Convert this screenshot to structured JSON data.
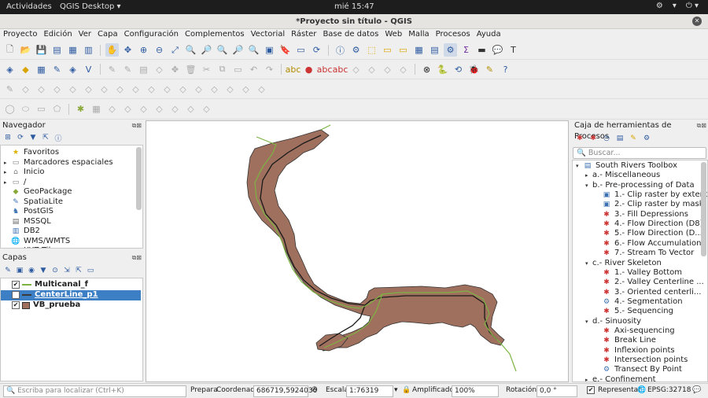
{
  "topbar": {
    "activities": "Actividades",
    "app": "QGIS Desktop ▾",
    "clock": "mié 15:47",
    "sys": [
      "⚙",
      "▾",
      "⏻ ▾"
    ]
  },
  "window": {
    "title": "*Proyecto sin título - QGIS"
  },
  "menu": [
    "Proyecto",
    "Edición",
    "Ver",
    "Capa",
    "Configuración",
    "Complementos",
    "Vectorial",
    "Ráster",
    "Base de datos",
    "Web",
    "Malla",
    "Procesos",
    "Ayuda"
  ],
  "browser": {
    "title": "Navegador",
    "items": [
      {
        "label": "Favoritos",
        "icon": "★",
        "color": "#e0b000",
        "expand": ""
      },
      {
        "label": "Marcadores espaciales",
        "icon": "▭",
        "color": "#777",
        "expand": "▸"
      },
      {
        "label": "Inicio",
        "icon": "⌂",
        "color": "#777",
        "expand": "▸"
      },
      {
        "label": "/",
        "icon": "▭",
        "color": "#777",
        "expand": "▸"
      },
      {
        "label": "GeoPackage",
        "icon": "◆",
        "color": "#8aa83a",
        "expand": ""
      },
      {
        "label": "SpatiaLite",
        "icon": "✎",
        "color": "#3a6fb0",
        "expand": ""
      },
      {
        "label": "PostGIS",
        "icon": "♞",
        "color": "#3a6fb0",
        "expand": ""
      },
      {
        "label": "MSSQL",
        "icon": "▤",
        "color": "#666",
        "expand": ""
      },
      {
        "label": "DB2",
        "icon": "▥",
        "color": "#3a6fb0",
        "expand": ""
      },
      {
        "label": "WMS/WMTS",
        "icon": "🌐",
        "color": "#3a6fb0",
        "expand": ""
      },
      {
        "label": "XYZ Tiles",
        "icon": "▦",
        "color": "#666",
        "expand": ""
      }
    ]
  },
  "layers": {
    "title": "Capas",
    "items": [
      {
        "label": "Multicanal_f",
        "kind": "line",
        "color": "#7cb342",
        "selected": false
      },
      {
        "label": "CenterLine_p1",
        "kind": "line",
        "color": "#3a3a3a",
        "selected": true
      },
      {
        "label": "VB_prueba",
        "kind": "poly",
        "color": "#a0705e",
        "selected": false
      }
    ]
  },
  "toolbox": {
    "title": "Caja de herramientas de Procesos",
    "search_placeholder": "Buscar...",
    "items": [
      {
        "label": "South Rivers Toolbox",
        "level": 0,
        "expand": "▾",
        "icon": "▤"
      },
      {
        "label": "a.- Miscellaneous",
        "level": 1,
        "expand": "▸",
        "icon": ""
      },
      {
        "label": "b.- Pre-processing of Data",
        "level": 1,
        "expand": "▾",
        "icon": ""
      },
      {
        "label": "1.- Clip raster by extent",
        "level": 2,
        "expand": "",
        "icon": "▣"
      },
      {
        "label": "2.- Clip raster by mask",
        "level": 2,
        "expand": "",
        "icon": "▣"
      },
      {
        "label": "3.- Fill Depressions",
        "level": 2,
        "expand": "",
        "icon": "✱"
      },
      {
        "label": "4.- Flow Direction (D8)",
        "level": 2,
        "expand": "",
        "icon": "✱"
      },
      {
        "label": "5.- Flow Direction (D...",
        "level": 2,
        "expand": "",
        "icon": "✱"
      },
      {
        "label": "6.- Flow Accumulation",
        "level": 2,
        "expand": "",
        "icon": "✱"
      },
      {
        "label": "7.- Stream To Vector",
        "level": 2,
        "expand": "",
        "icon": "✱"
      },
      {
        "label": "c.- River Skeleton",
        "level": 1,
        "expand": "▾",
        "icon": ""
      },
      {
        "label": "1.- Valley Bottom",
        "level": 2,
        "expand": "",
        "icon": "✱"
      },
      {
        "label": "2.- Valley Centerline ...",
        "level": 2,
        "expand": "",
        "icon": "✱"
      },
      {
        "label": "3.- Oriented centerli...",
        "level": 2,
        "expand": "",
        "icon": "✱"
      },
      {
        "label": "4.- Segmentation",
        "level": 2,
        "expand": "",
        "icon": "⚙"
      },
      {
        "label": "5.- Sequencing",
        "level": 2,
        "expand": "",
        "icon": "✱"
      },
      {
        "label": "d.- Sinuosity",
        "level": 1,
        "expand": "▾",
        "icon": ""
      },
      {
        "label": "Axi-sequencing",
        "level": 2,
        "expand": "",
        "icon": "✱"
      },
      {
        "label": "Break Line",
        "level": 2,
        "expand": "",
        "icon": "✱"
      },
      {
        "label": "Inflexion points",
        "level": 2,
        "expand": "",
        "icon": "✱"
      },
      {
        "label": "Intersection points",
        "level": 2,
        "expand": "",
        "icon": "✱"
      },
      {
        "label": "Transect By Point",
        "level": 2,
        "expand": "",
        "icon": "⚙"
      },
      {
        "label": "e.- Confinement",
        "level": 1,
        "expand": "▸",
        "icon": ""
      }
    ]
  },
  "status": {
    "search_placeholder": "Escriba para localizar (Ctrl+K)",
    "ready": "Prepara",
    "coord_label": "Coordenada",
    "coord": "686719,5924030",
    "scale_label": "Escala",
    "scale": "1:76319",
    "mag_label": "Amplificador",
    "mag": "100%",
    "rot_label": "Rotación",
    "rot": "0,0 °",
    "render_label": "Representar",
    "crs": "EPSG:32718"
  },
  "colors": {
    "valley": "#a0705e",
    "centerline": "#1a1a1a",
    "multicanal": "#7cb342",
    "selected": "#3d7fc4"
  }
}
